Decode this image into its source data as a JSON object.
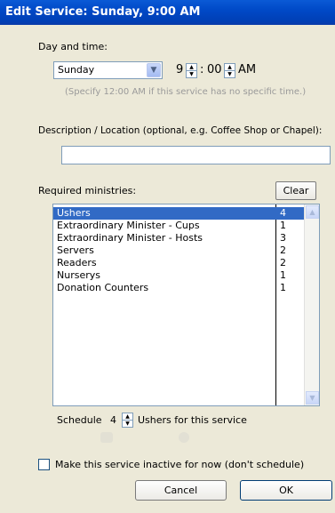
{
  "window": {
    "title": "Edit Service: Sunday, 9:00 AM"
  },
  "day_time": {
    "label": "Day and time:",
    "day_value": "Sunday",
    "hour": "9",
    "separator": ":",
    "minute": "00",
    "ampm": "AM",
    "hint": "(Specify 12:00 AM if this service has no specific time.)"
  },
  "description": {
    "label": "Description / Location (optional, e.g. Coffee Shop or Chapel):",
    "value": ""
  },
  "ministries": {
    "label": "Required ministries:",
    "clear_label": "Clear",
    "items": [
      {
        "name": "Ushers",
        "count": "4",
        "selected": true
      },
      {
        "name": "Extraordinary Minister - Cups",
        "count": "1"
      },
      {
        "name": "Extraordinary Minister - Hosts",
        "count": "3"
      },
      {
        "name": "Servers",
        "count": "2"
      },
      {
        "name": "Readers",
        "count": "2"
      },
      {
        "name": "Nurserys",
        "count": "1"
      },
      {
        "name": "Donation Counters",
        "count": "1"
      }
    ]
  },
  "schedule": {
    "prefix": "Schedule",
    "value": "4",
    "suffix": "Ushers for this service"
  },
  "inactive": {
    "label": "Make this service inactive for now (don't schedule)",
    "checked": false
  },
  "buttons": {
    "cancel": "Cancel",
    "ok": "OK"
  }
}
